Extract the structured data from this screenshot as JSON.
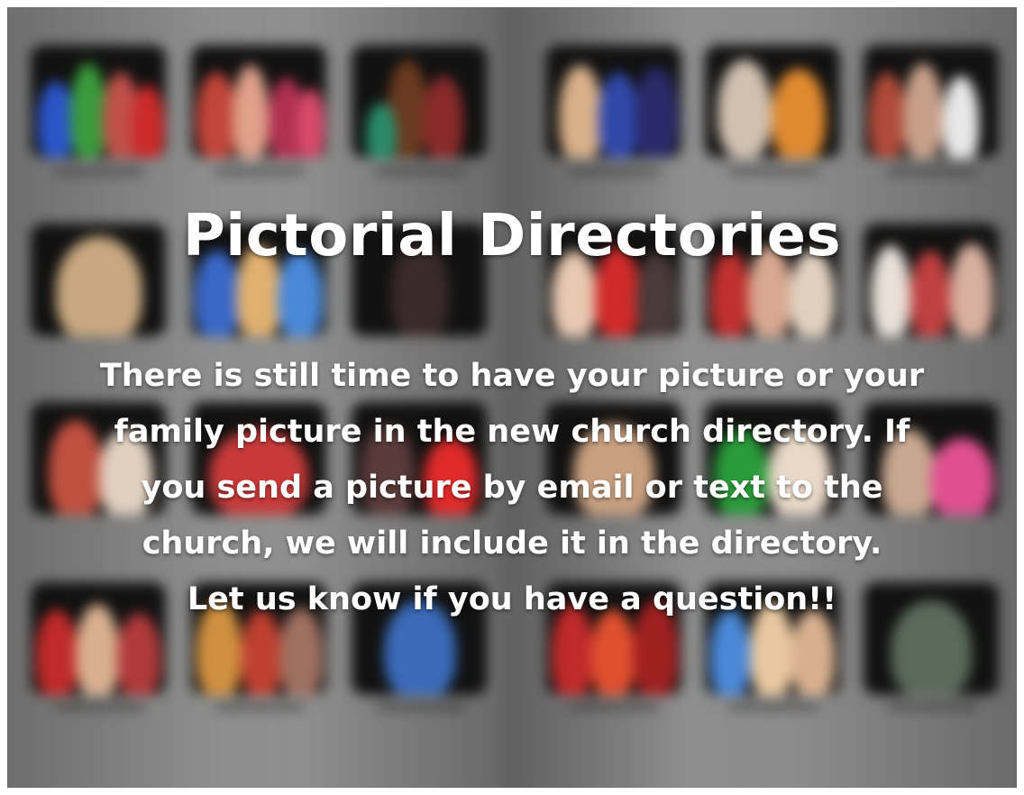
{
  "title": "Pictorial Directories",
  "message_lines": [
    "There is still time to have your picture or your",
    "family picture in the new church directory.  If",
    "you send a picture by email or text to the",
    "church, we will include it in the directory.",
    "Let us know if you have a question!!"
  ]
}
